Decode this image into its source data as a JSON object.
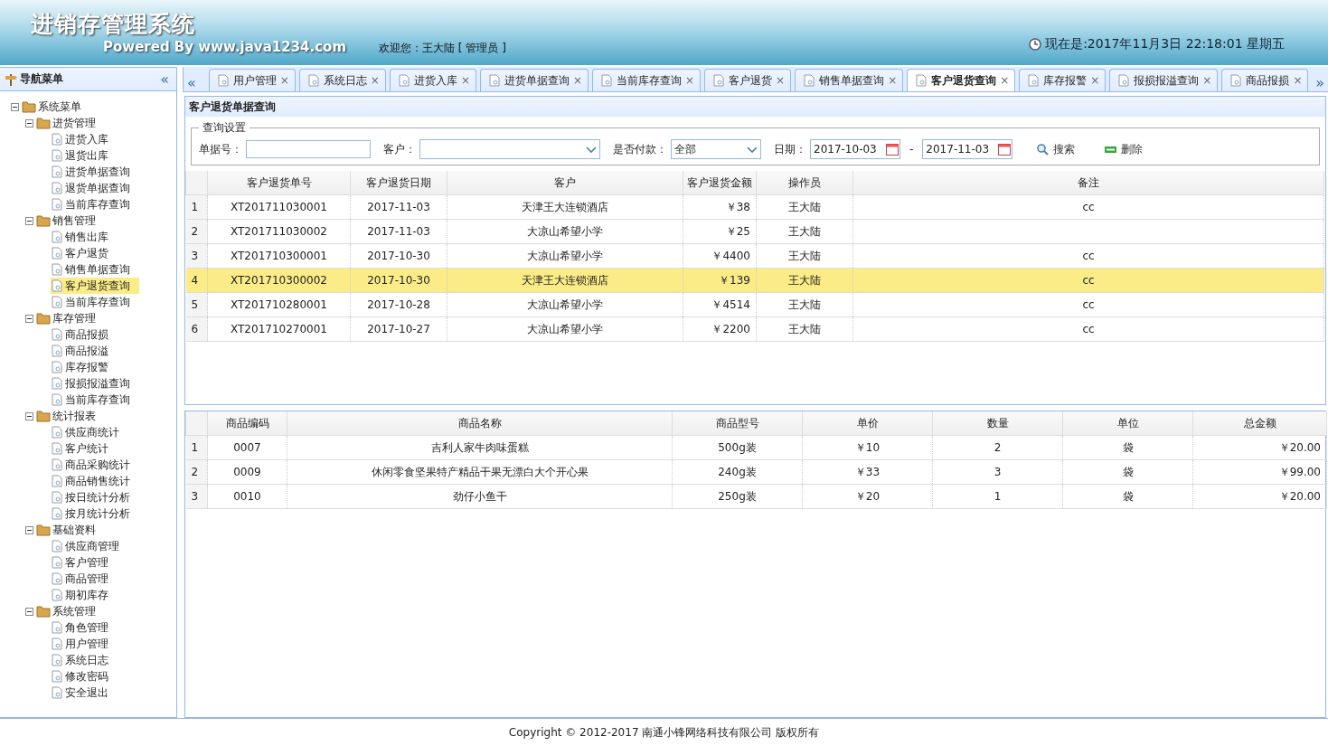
{
  "header": {
    "title": "进销存管理系统",
    "powered": "Powered By www.java1234.com",
    "welcome": "欢迎您：王大陆 [ 管理员 ]",
    "clock": "现在是:2017年11月3日 22:18:01 星期五"
  },
  "sidebar": {
    "title": "导航菜单",
    "collapse": "«",
    "items": [
      {
        "label": "系统菜单",
        "expanded": true,
        "selected": false,
        "children": [
          {
            "label": "进货管理",
            "expanded": true,
            "selected": false,
            "children": [
              {
                "label": "进货入库",
                "selected": false
              },
              {
                "label": "退货出库",
                "selected": false
              },
              {
                "label": "进货单据查询",
                "selected": false
              },
              {
                "label": "退货单据查询",
                "selected": false
              },
              {
                "label": "当前库存查询",
                "selected": false
              }
            ]
          },
          {
            "label": "销售管理",
            "expanded": true,
            "selected": false,
            "children": [
              {
                "label": "销售出库",
                "selected": false
              },
              {
                "label": "客户退货",
                "selected": false
              },
              {
                "label": "销售单据查询",
                "selected": false
              },
              {
                "label": "客户退货查询",
                "selected": true
              },
              {
                "label": "当前库存查询",
                "selected": false
              }
            ]
          },
          {
            "label": "库存管理",
            "expanded": true,
            "selected": false,
            "children": [
              {
                "label": "商品报损",
                "selected": false
              },
              {
                "label": "商品报溢",
                "selected": false
              },
              {
                "label": "库存报警",
                "selected": false
              },
              {
                "label": "报损报溢查询",
                "selected": false
              },
              {
                "label": "当前库存查询",
                "selected": false
              }
            ]
          },
          {
            "label": "统计报表",
            "expanded": true,
            "selected": false,
            "children": [
              {
                "label": "供应商统计",
                "selected": false
              },
              {
                "label": "客户统计",
                "selected": false
              },
              {
                "label": "商品采购统计",
                "selected": false
              },
              {
                "label": "商品销售统计",
                "selected": false
              },
              {
                "label": "按日统计分析",
                "selected": false
              },
              {
                "label": "按月统计分析",
                "selected": false
              }
            ]
          },
          {
            "label": "基础资料",
            "expanded": true,
            "selected": false,
            "children": [
              {
                "label": "供应商管理",
                "selected": false
              },
              {
                "label": "客户管理",
                "selected": false
              },
              {
                "label": "商品管理",
                "selected": false
              },
              {
                "label": "期初库存",
                "selected": false
              }
            ]
          },
          {
            "label": "系统管理",
            "expanded": true,
            "selected": false,
            "children": [
              {
                "label": "角色管理",
                "selected": false
              },
              {
                "label": "用户管理",
                "selected": false
              },
              {
                "label": "系统日志",
                "selected": false
              },
              {
                "label": "修改密码",
                "selected": false
              },
              {
                "label": "安全退出",
                "selected": false
              }
            ]
          }
        ]
      }
    ]
  },
  "tabs": {
    "scroll_left": "«",
    "scroll_right": "»",
    "items": [
      {
        "label": "用户管理",
        "close": "×",
        "selected": false
      },
      {
        "label": "系统日志",
        "close": "×",
        "selected": false
      },
      {
        "label": "进货入库",
        "close": "×",
        "selected": false
      },
      {
        "label": "进货单据查询",
        "close": "×",
        "selected": false
      },
      {
        "label": "当前库存查询",
        "close": "×",
        "selected": false
      },
      {
        "label": "客户退货",
        "close": "×",
        "selected": false
      },
      {
        "label": "销售单据查询",
        "close": "×",
        "selected": false
      },
      {
        "label": "客户退货查询",
        "close": "×",
        "selected": true
      },
      {
        "label": "库存报警",
        "close": "×",
        "selected": false
      },
      {
        "label": "报损报溢查询",
        "close": "×",
        "selected": false
      },
      {
        "label": "商品报损",
        "close": "×",
        "selected": false
      }
    ]
  },
  "panel": {
    "title": "客户退货单据查询"
  },
  "query": {
    "legend": "查询设置",
    "bill_no": {
      "label": "单据号："
    },
    "customer": {
      "label": "客户："
    },
    "paid": {
      "label": "是否付款：",
      "value": "全部"
    },
    "date": {
      "label": "日期：",
      "from": "2017-10-03",
      "separator": "-",
      "to": "2017-11-03"
    },
    "buttons": [
      {
        "kind": "search",
        "label": "搜索"
      },
      {
        "kind": "delete",
        "label": "删除"
      }
    ]
  },
  "returns_table": {
    "columns": [
      "客户退货单号",
      "客户退货日期",
      "客户",
      "客户退货金额",
      "操作员",
      "备注"
    ],
    "rows": [
      {
        "index": "1",
        "cells": [
          "XT201711030001",
          "2017-11-03",
          "天津王大连锁酒店",
          "￥38",
          "王大陆",
          "cc"
        ],
        "selected": false
      },
      {
        "index": "2",
        "cells": [
          "XT201711030002",
          "2017-11-03",
          "大凉山希望小学",
          "￥25",
          "王大陆"
        ],
        "selected": false
      },
      {
        "index": "3",
        "cells": [
          "XT201710300001",
          "2017-10-30",
          "大凉山希望小学",
          "￥4400",
          "王大陆",
          "cc"
        ],
        "selected": false
      },
      {
        "index": "4",
        "cells": [
          "XT201710300002",
          "2017-10-30",
          "天津王大连锁酒店",
          "￥139",
          "王大陆",
          "cc"
        ],
        "selected": true
      },
      {
        "index": "5",
        "cells": [
          "XT201710280001",
          "2017-10-28",
          "大凉山希望小学",
          "￥4514",
          "王大陆",
          "cc"
        ],
        "selected": false
      },
      {
        "index": "6",
        "cells": [
          "XT201710270001",
          "2017-10-27",
          "大凉山希望小学",
          "￥2200",
          "王大陆",
          "cc"
        ],
        "selected": false
      }
    ]
  },
  "items_table": {
    "columns": [
      "商品编码",
      "商品名称",
      "商品型号",
      "单价",
      "数量",
      "单位",
      "总金额"
    ],
    "rows": [
      {
        "index": "1",
        "cells": [
          "0007",
          "吉利人家牛肉味蛋糕",
          "500g装",
          "￥10",
          "2",
          "袋",
          "￥20.00"
        ]
      },
      {
        "index": "2",
        "cells": [
          "0009",
          "休闲零食坚果特产精品干果无漂白大个开心果",
          "240g装",
          "￥33",
          "3",
          "袋",
          "￥99.00"
        ]
      },
      {
        "index": "3",
        "cells": [
          "0010",
          "劲仔小鱼干",
          "250g装",
          "￥20",
          "1",
          "袋",
          "￥20.00"
        ]
      }
    ]
  },
  "footer": {
    "copyright": "Copyright © 2012-2017 南通小锋网络科技有限公司 版权所有"
  }
}
